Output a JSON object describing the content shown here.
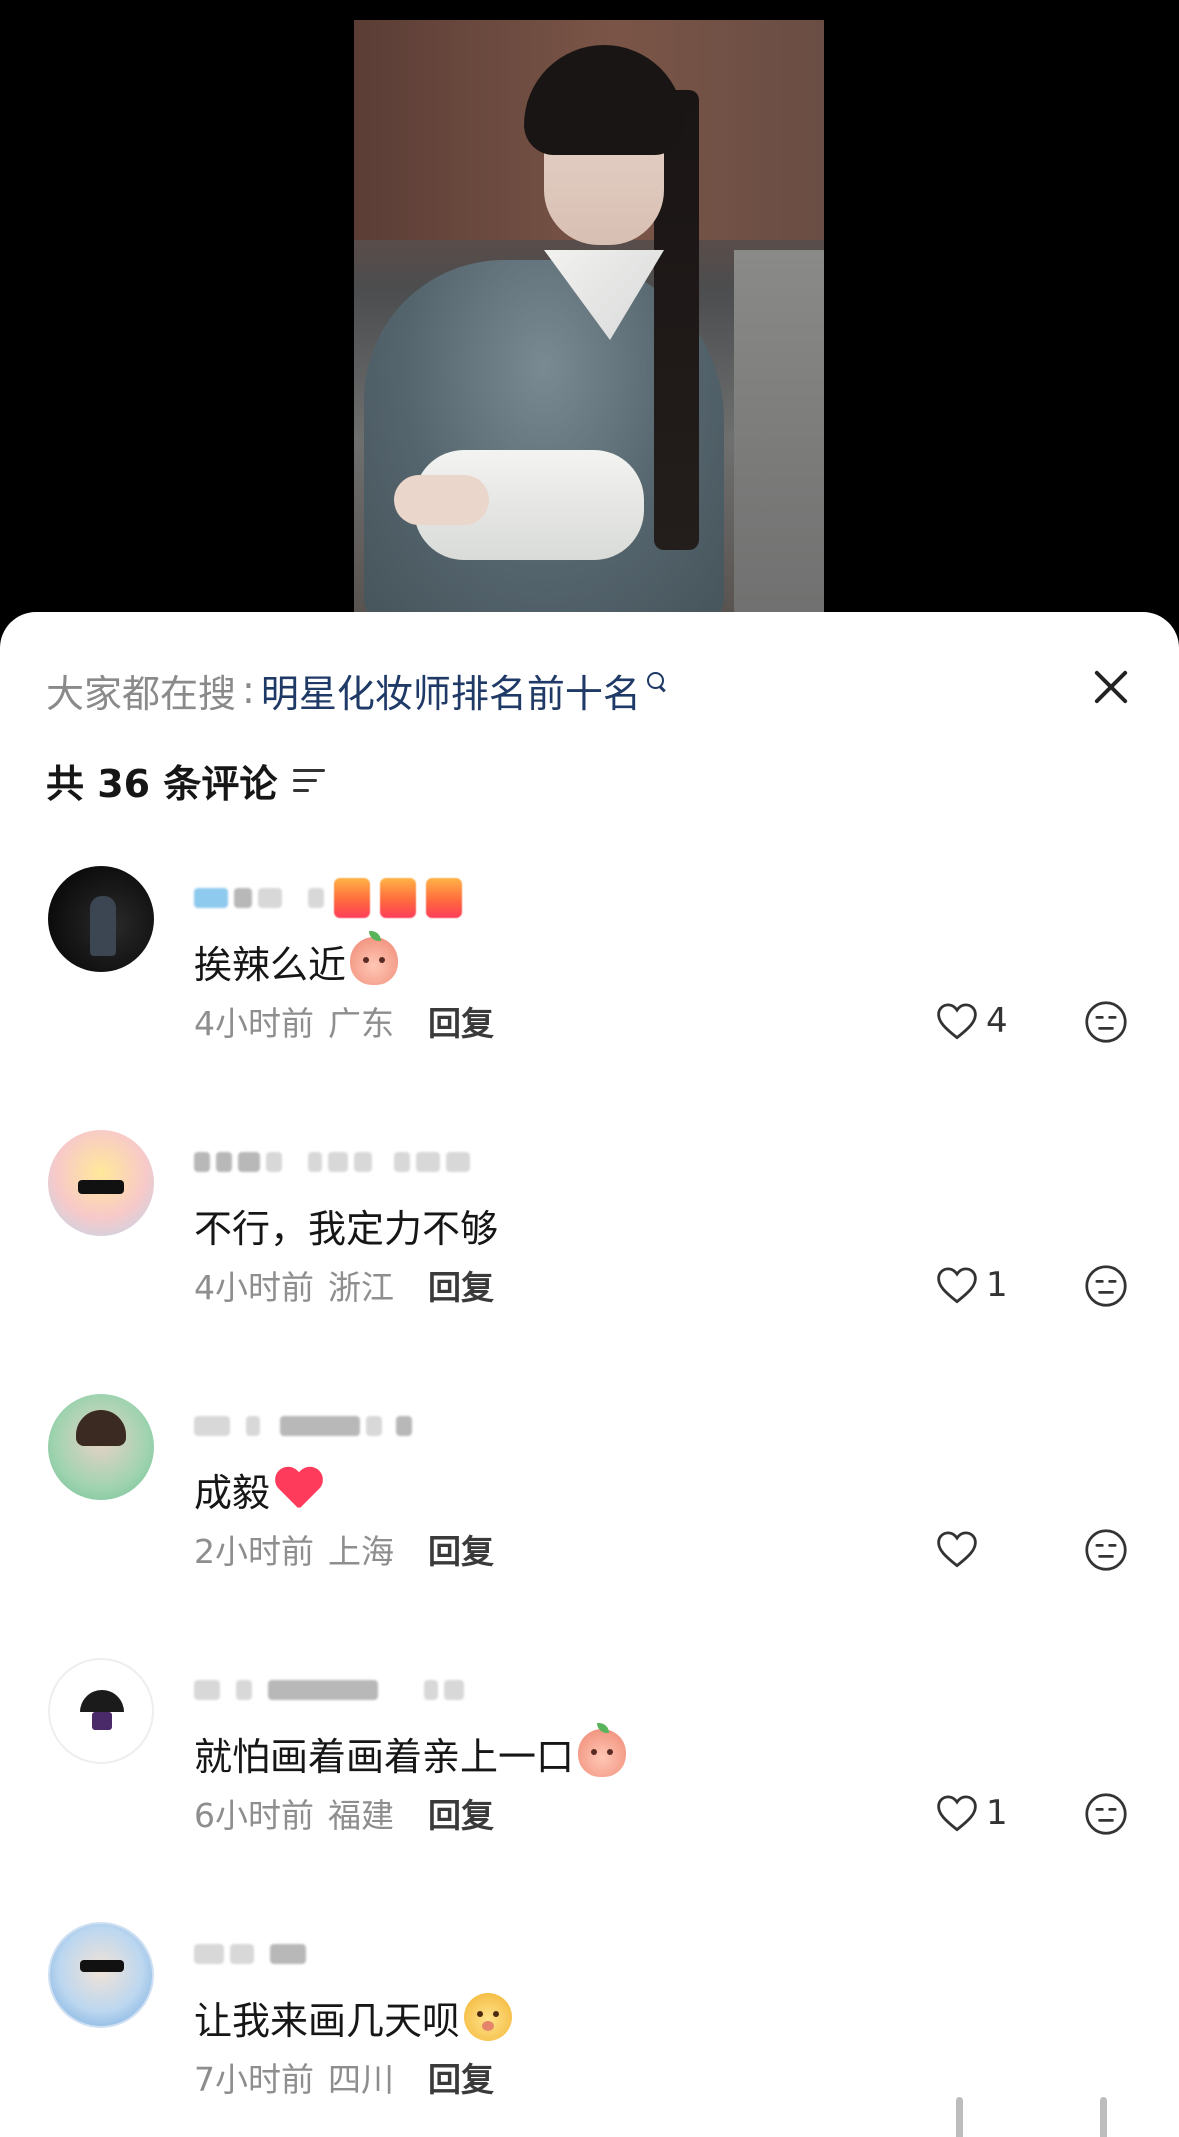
{
  "search": {
    "label": "大家都在搜",
    "colon": ":",
    "term": "明星化妆师排名前十名"
  },
  "comments_header": {
    "count_text": "共 36 条评论"
  },
  "comments": [
    {
      "text": "挨辣么近",
      "time": "4小时前",
      "location": "广东",
      "reply": "回复",
      "likes": "4",
      "emoji": "peach-wink"
    },
    {
      "text": "不行，我定力不够",
      "time": "4小时前",
      "location": "浙江",
      "reply": "回复",
      "likes": "1",
      "emoji": ""
    },
    {
      "text": "成毅",
      "time": "2小时前",
      "location": "上海",
      "reply": "回复",
      "likes": "",
      "emoji": "red-heart"
    },
    {
      "text": "就怕画着画着亲上一口",
      "time": "6小时前",
      "location": "福建",
      "reply": "回复",
      "likes": "1",
      "emoji": "peach-face"
    },
    {
      "text": "让我来画几天呗",
      "time": "7小时前",
      "location": "四川",
      "reply": "回复",
      "likes": "",
      "emoji": "yellow-dog"
    }
  ],
  "colors": {
    "search_term": "#1f3a66",
    "muted_text": "#8e8e8e",
    "body_text": "#161616",
    "sheet_bg": "#ffffff",
    "page_bg": "#000000"
  }
}
